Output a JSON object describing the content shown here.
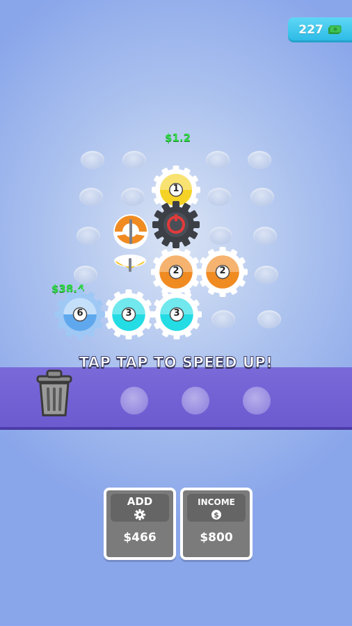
{
  "hud": {
    "currency": "227",
    "currency_icon": "cash-icon"
  },
  "floating_rewards": [
    "$1.2",
    "$38.4"
  ],
  "gears": {
    "g1": {
      "level": "1",
      "color": "#f5d326"
    },
    "g2a": {
      "level": "2",
      "color": "#f08b22"
    },
    "g2b": {
      "level": "2",
      "color": "#f08b22"
    },
    "g3a": {
      "level": "3",
      "color": "#24dce4"
    },
    "g3b": {
      "level": "3",
      "color": "#24dce4"
    },
    "g6": {
      "level": "6",
      "color": "#5fa8ee"
    }
  },
  "banner": {
    "text": "TAP TAP TO SPEED UP!"
  },
  "shop": {
    "add": {
      "label": "ADD",
      "price": "$466",
      "icon": "gear-icon"
    },
    "income": {
      "label": "INCOME",
      "price": "$800",
      "icon": "coin-icon"
    }
  },
  "colors": {
    "banner": "#7263d4",
    "button": "#7b7b7b",
    "currency_bg": "#3cc8ef",
    "reward_text": "#33d94a"
  }
}
